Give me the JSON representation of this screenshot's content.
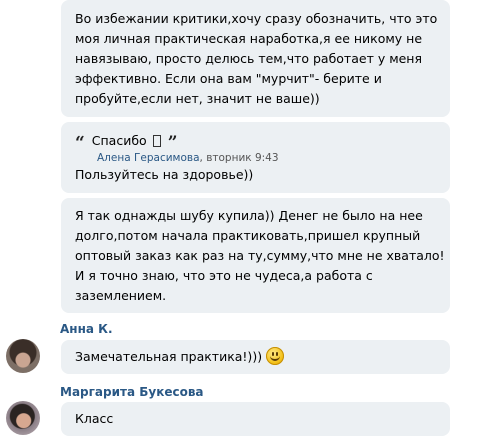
{
  "messages": [
    {
      "lines": [
        "Во избежании критики,хочу сразу обозначить, что это",
        "моя личная практическая наработка,я ее никому не",
        "навязываю, просто делюсь тем,что работает у меня",
        "эффективно. Если она вам \"мурчит\"- берите и",
        "пробуйте,если нет, значит не ваше))"
      ]
    },
    {
      "quote": {
        "text": "Спасибо",
        "author": "Алена Герасимова",
        "time": ", вторник 9:43"
      },
      "text": "Пользуйтесь на здоровье))"
    },
    {
      "lines": [
        "Я так однажды шубу купила)) Денег не было на нее",
        "долго,потом начала практиковать,пришел крупный",
        "оптовый заказ как раз на ту,сумму,что мне не хватало!",
        "И я точно знаю, что это не чудеса,а работа с",
        "заземлением."
      ]
    },
    {
      "author": "Анна К.",
      "text": "Замечательная практика!)))",
      "emoji": "smiley-emoji"
    },
    {
      "author": "Маргарита Букесова",
      "text": "Класс"
    }
  ],
  "colors": {
    "bubble_bg": "#ecf0f3",
    "author_name": "#2a5885"
  }
}
